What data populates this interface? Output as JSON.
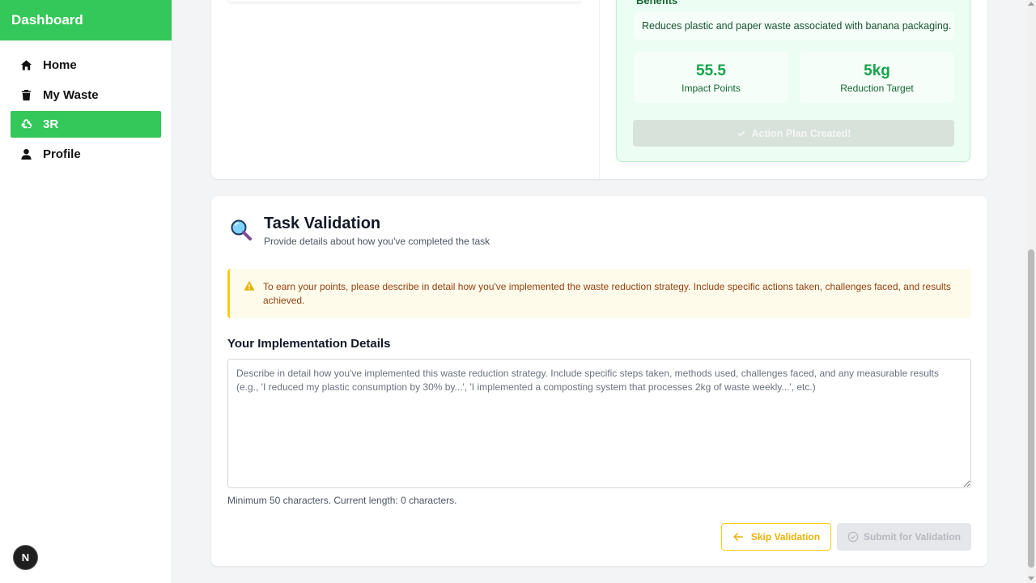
{
  "sidebar": {
    "brand": "Dashboard",
    "items": [
      {
        "label": "Home",
        "icon": "home-icon",
        "active": false
      },
      {
        "label": "My Waste",
        "icon": "trash-icon",
        "active": false
      },
      {
        "label": "3R",
        "icon": "recycle-icon",
        "active": true
      },
      {
        "label": "Profile",
        "icon": "user-icon",
        "active": false
      }
    ],
    "badge": "N"
  },
  "benefits": {
    "heading": "Benefits",
    "text": "Reduces plastic and paper waste associated with banana packaging.",
    "stats": [
      {
        "value": "55.5",
        "label": "Impact Points"
      },
      {
        "value": "5kg",
        "label": "Reduction Target"
      }
    ],
    "action_label": "Action Plan Created!"
  },
  "task_validation": {
    "title": "Task Validation",
    "subtitle": "Provide details about how you've completed the task",
    "warning": "To earn your points, please describe in detail how you've implemented the waste reduction strategy. Include specific actions taken, challenges faced, and results achieved.",
    "details_label": "Your Implementation Details",
    "details_value": "",
    "details_placeholder": "Describe in detail how you've implemented this waste reduction strategy. Include specific steps taken, methods used, challenges faced, and any measurable results (e.g., 'I reduced my plastic consumption by 30% by...', 'I implemented a composting system that processes 2kg of waste weekly...', etc.)",
    "char_count": "Minimum 50 characters. Current length: 0 characters.",
    "skip_label": "Skip Validation",
    "submit_label": "Submit for Validation"
  },
  "colors": {
    "brand_green": "#34c759",
    "stat_green": "#16a34a",
    "warning_yellow": "#facc15"
  }
}
